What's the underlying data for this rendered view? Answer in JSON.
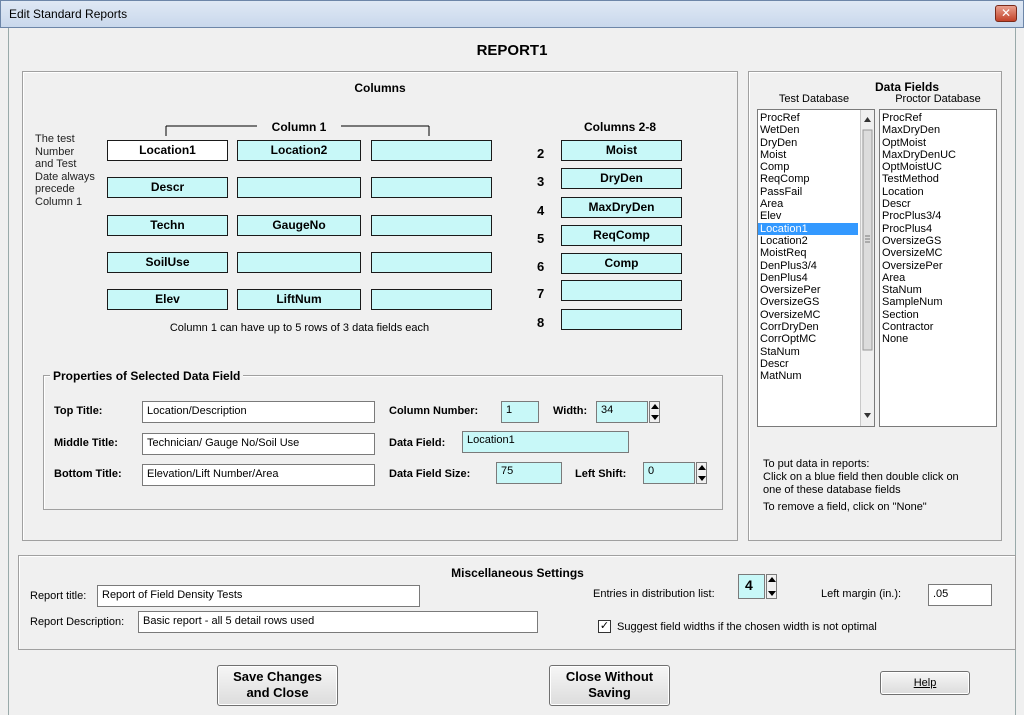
{
  "window": {
    "title": "Edit Standard Reports",
    "close_glyph": "✕"
  },
  "report_name": "REPORT1",
  "columns_section": {
    "title": "Columns",
    "column1_header": "Column 1",
    "columns28_header": "Columns 2-8",
    "note": "The test Number and Test Date always precede Column 1",
    "rows": [
      [
        "Location1",
        "Location2",
        ""
      ],
      [
        "Descr",
        "",
        ""
      ],
      [
        "Techn",
        "GaugeNo",
        ""
      ],
      [
        "SoilUse",
        "",
        ""
      ],
      [
        "Elev",
        "LiftNum",
        ""
      ]
    ],
    "footnote": "Column 1 can have up to 5 rows of 3 data fields each",
    "other_columns": [
      {
        "num": "2",
        "field": "Moist"
      },
      {
        "num": "3",
        "field": "DryDen"
      },
      {
        "num": "4",
        "field": "MaxDryDen"
      },
      {
        "num": "5",
        "field": "ReqComp"
      },
      {
        "num": "6",
        "field": "Comp"
      },
      {
        "num": "7",
        "field": ""
      },
      {
        "num": "8",
        "field": ""
      }
    ]
  },
  "properties": {
    "title": "Properties of Selected Data Field",
    "top_title_label": "Top Title:",
    "top_title_value": "Location/Description",
    "middle_title_label": "Middle Title:",
    "middle_title_value": "Technician/ Gauge No/Soil Use",
    "bottom_title_label": "Bottom Title:",
    "bottom_title_value": "Elevation/Lift Number/Area",
    "column_number_label": "Column Number:",
    "column_number_value": "1",
    "width_label": "Width:",
    "width_value": "34",
    "data_field_label": "Data Field:",
    "data_field_value": "Location1",
    "data_field_size_label": "Data Field Size:",
    "data_field_size_value": "75",
    "left_shift_label": "Left Shift:",
    "left_shift_value": "0"
  },
  "data_fields": {
    "title": "Data Fields",
    "test_db_label": "Test Database",
    "proctor_db_label": "Proctor Database",
    "test_items": [
      "ProcRef",
      "WetDen",
      "DryDen",
      "Moist",
      "Comp",
      "ReqComp",
      "PassFail",
      "Area",
      "Elev",
      "Location1",
      "Location2",
      "MoistReq",
      "DenPlus3/4",
      "DenPlus4",
      "OversizePer",
      "OversizeGS",
      "OversizeMC",
      "CorrDryDen",
      "CorrOptMC",
      "StaNum",
      "Descr",
      "MatNum"
    ],
    "test_selected_index": 9,
    "proctor_items": [
      "ProcRef",
      "MaxDryDen",
      "OptMoist",
      "MaxDryDenUC",
      "OptMoistUC",
      "TestMethod",
      "Location",
      "Descr",
      "ProcPlus3/4",
      "ProcPlus4",
      "OversizeGS",
      "OversizeMC",
      "OversizePer",
      "Area",
      "StaNum",
      "SampleNum",
      "Section",
      "Contractor",
      "None"
    ],
    "help1": "To put data in reports:",
    "help2": "Click on a blue field then double click on",
    "help3": "one of these database fields",
    "help4": "To remove a field, click on \"None\""
  },
  "misc": {
    "title": "Miscellaneous Settings",
    "report_title_label": "Report title:",
    "report_title_value": "Report of Field Density Tests",
    "report_desc_label": "Report Description:",
    "report_desc_value": "Basic report - all 5 detail rows used",
    "entries_label": "Entries in distribution list:",
    "entries_value": "4",
    "left_margin_label": "Left margin (in.):",
    "left_margin_value": ".05",
    "suggest_label": "Suggest field widths if the chosen width is not optimal",
    "suggest_checked": "✓"
  },
  "buttons": {
    "save_line1": "Save Changes",
    "save_line2": "and Close",
    "close_line1": "Close Without",
    "close_line2": "Saving",
    "help": "Help"
  }
}
